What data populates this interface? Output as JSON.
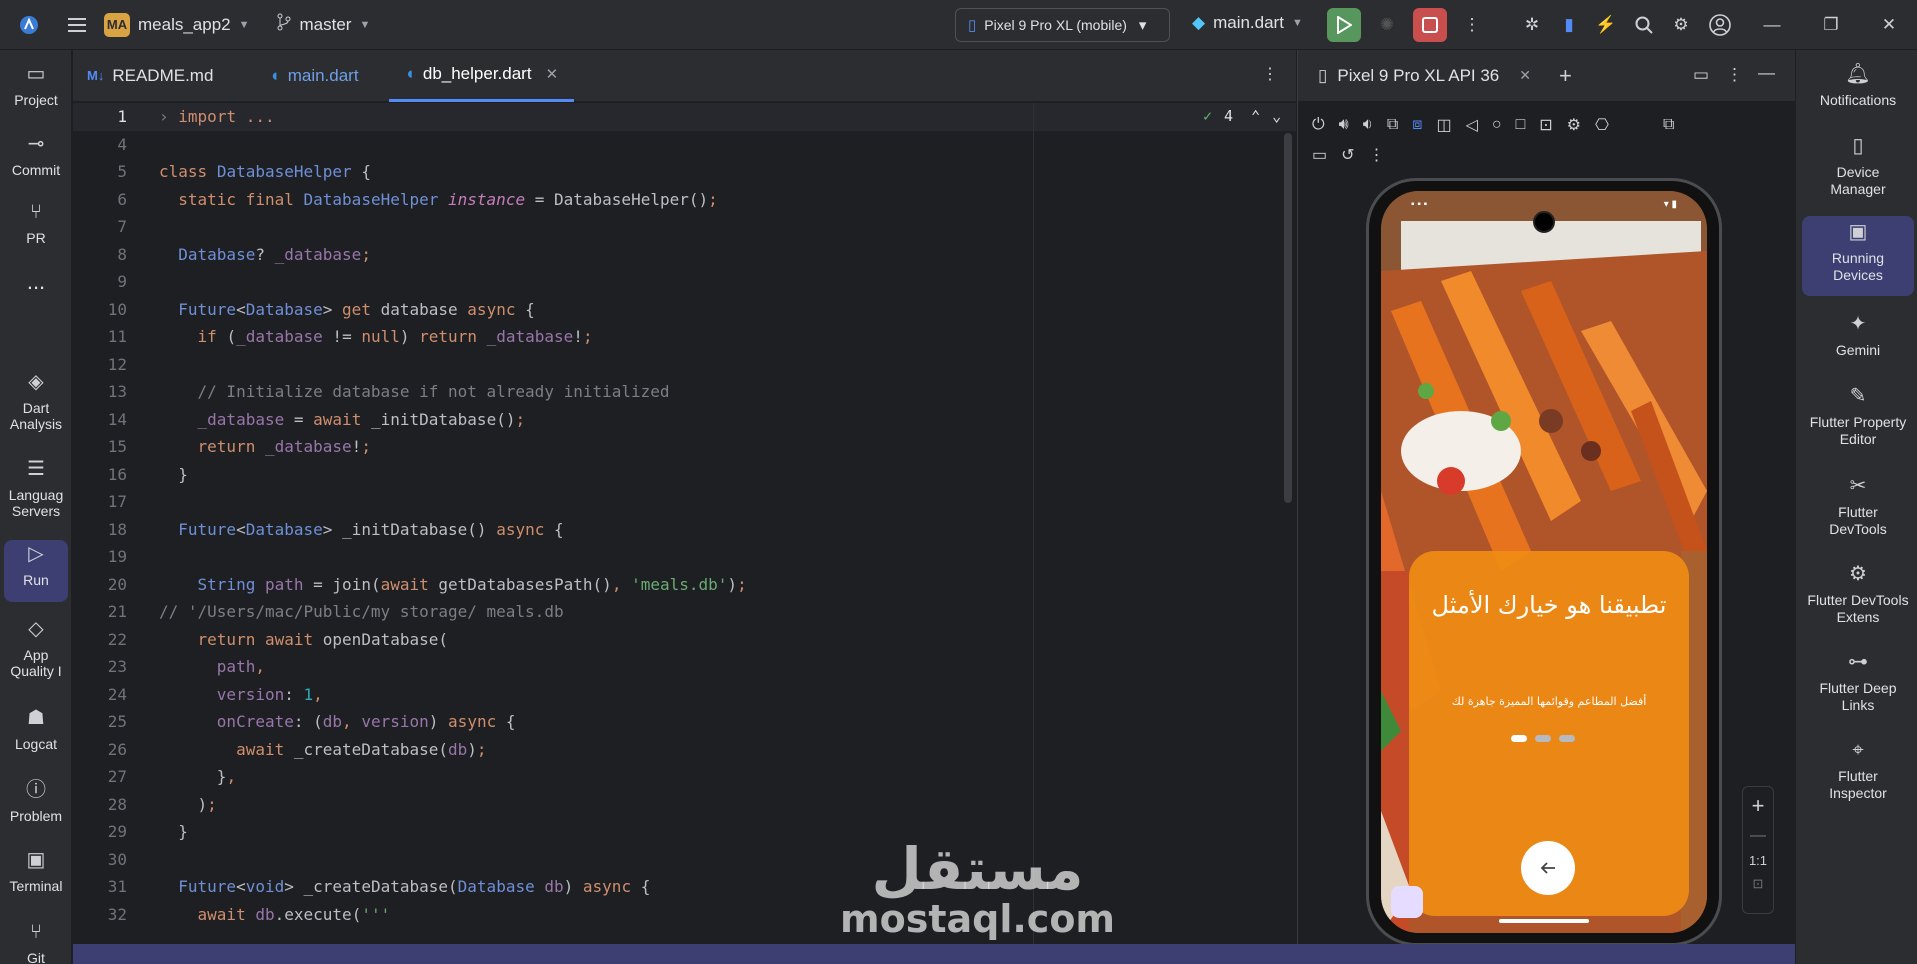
{
  "toolbar": {
    "project_initials": "MA",
    "project_name": "meals_app2",
    "branch": "master",
    "device": "Pixel 9 Pro XL (mobile)",
    "run_config": "main.dart"
  },
  "left_tools": [
    {
      "label": "Project",
      "icon": "folder-icon"
    },
    {
      "label": "Commit",
      "icon": "commit-icon"
    },
    {
      "label": "PR",
      "icon": "pull-request-icon"
    },
    {
      "label": "...",
      "icon": "more-icon"
    },
    {
      "label": "Dart Analysis",
      "icon": "dart-analysis-icon"
    },
    {
      "label": "Languag Servers",
      "icon": "language-servers-icon"
    },
    {
      "label": "Run",
      "icon": "run-icon"
    },
    {
      "label": "App Quality I",
      "icon": "app-quality-icon"
    },
    {
      "label": "Logcat",
      "icon": "logcat-icon"
    },
    {
      "label": "Problem",
      "icon": "problems-icon"
    },
    {
      "label": "Terminal",
      "icon": "terminal-icon"
    },
    {
      "label": "Git",
      "icon": "git-icon"
    }
  ],
  "tabs": [
    {
      "label": "README.md",
      "icon": "markdown-icon"
    },
    {
      "label": "main.dart",
      "icon": "dart-file-icon"
    },
    {
      "label": "db_helper.dart",
      "icon": "dart-file-icon",
      "active": true
    }
  ],
  "inspection": {
    "count": "4"
  },
  "code": {
    "line_numbers": [
      "1",
      "4",
      "5",
      "6",
      "7",
      "8",
      "9",
      "10",
      "11",
      "12",
      "13",
      "14",
      "15",
      "16",
      "17",
      "18",
      "19",
      "20",
      "21",
      "22",
      "23",
      "24",
      "25",
      "26",
      "27",
      "28",
      "29",
      "30",
      "31",
      "32"
    ],
    "first_line": "import ...",
    "lines": [
      "",
      "class DatabaseHelper {",
      "  static final DatabaseHelper instance = DatabaseHelper();",
      "",
      "  Database? _database;",
      "",
      "  Future<Database> get database async {",
      "    if (_database != null) return _database!;",
      "",
      "    // Initialize database if not already initialized",
      "    _database = await _initDatabase();",
      "    return _database!;",
      "  }",
      "",
      "  Future<Database> _initDatabase() async {",
      "",
      "    String path = join(await getDatabasesPath(), 'meals.db');",
      "// '/Users/mac/Public/my storage/ meals.db",
      "    return await openDatabase(",
      "      path,",
      "      version: 1,",
      "      onCreate: (db, version) async {",
      "        await _createDatabase(db);",
      "      },",
      "    );",
      "  }",
      "",
      "  Future<void> _createDatabase(Database db) async {",
      "    await db.execute('''"
    ]
  },
  "emulator": {
    "tab_label": "Pixel 9 Pro XL API 36",
    "zoom_label": "1:1",
    "app": {
      "title": "تطبيقنا هو خيارك الأمثل",
      "subtitle": "أفضل المطاعم وقوائمها المميزة جاهزة لك",
      "page_count": 3,
      "active_page": 1
    }
  },
  "right_tools": [
    {
      "label": "Notifications",
      "icon": "bell-icon"
    },
    {
      "label": "Device Manager",
      "icon": "device-manager-icon"
    },
    {
      "label": "Running Devices",
      "icon": "running-devices-icon"
    },
    {
      "label": "Gemini",
      "icon": "gemini-icon"
    },
    {
      "label": "Flutter Property Editor",
      "icon": "property-editor-icon"
    },
    {
      "label": "Flutter DevTools",
      "icon": "devtools-icon"
    },
    {
      "label": "Flutter DevTools Extens",
      "icon": "devtools-extensions-icon"
    },
    {
      "label": "Flutter Deep Links",
      "icon": "deep-links-icon"
    },
    {
      "label": "Flutter Inspector",
      "icon": "inspector-icon"
    }
  ],
  "watermark": {
    "arabic": "مستقل",
    "latin": "mostaql.com"
  },
  "colors": {
    "accent": "#548af7",
    "run_green": "#57965c",
    "stop_red": "#c94f4f",
    "active_tool": "#3d3f73",
    "app_orange": "#f08c14"
  }
}
